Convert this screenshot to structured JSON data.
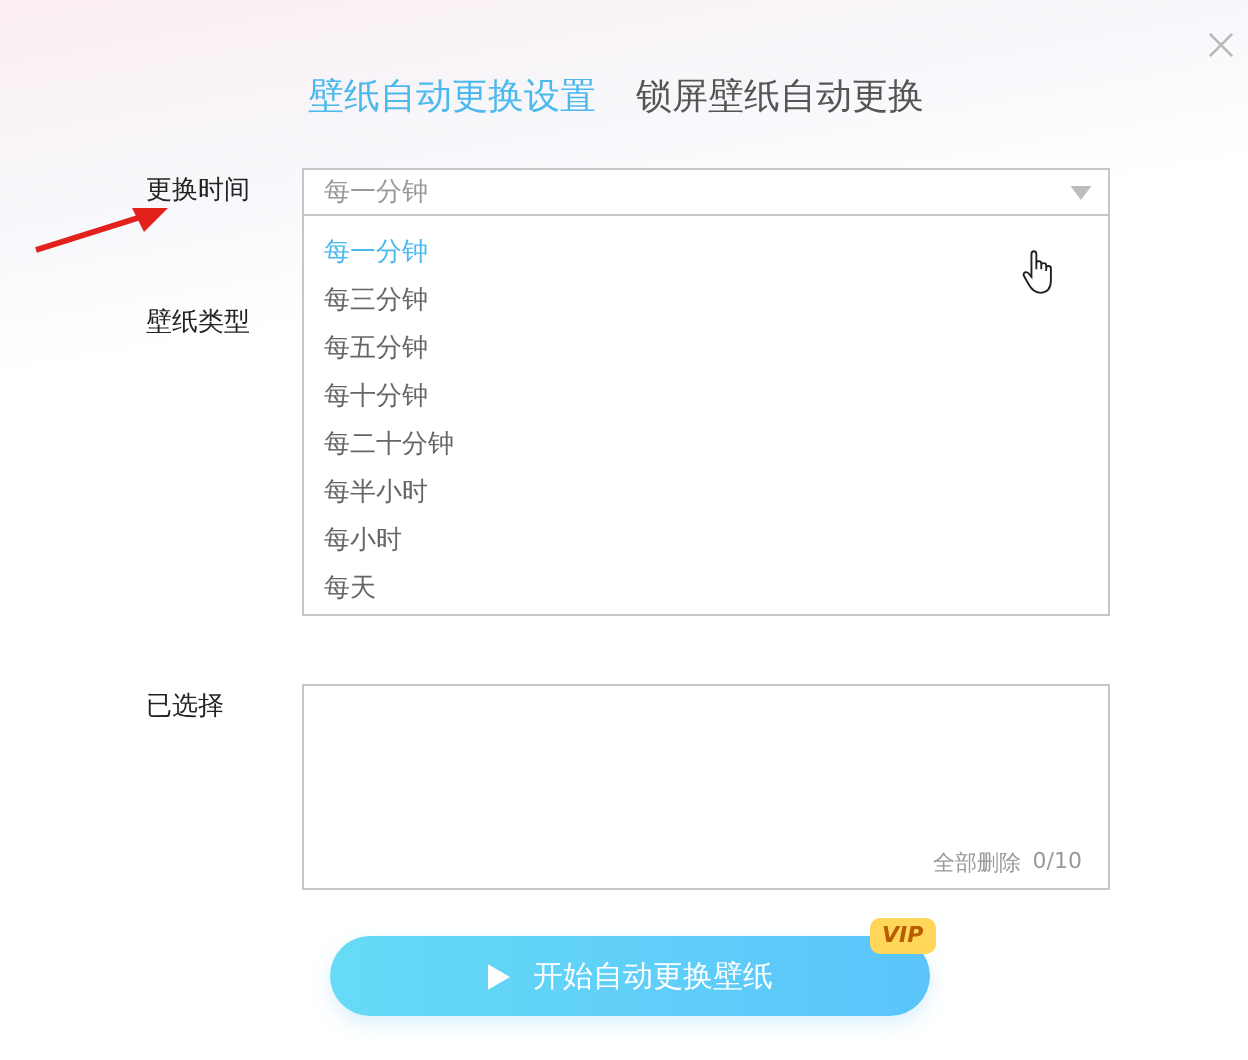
{
  "tabs": [
    {
      "label": "壁纸自动更换设置",
      "selected": true
    },
    {
      "label": "锁屏壁纸自动更换",
      "selected": false
    }
  ],
  "interval": {
    "label": "更换时间",
    "value": "每一分钟",
    "expanded": true,
    "options": [
      {
        "label": "每一分钟",
        "selected": true
      },
      {
        "label": "每三分钟",
        "selected": false
      },
      {
        "label": "每五分钟",
        "selected": false
      },
      {
        "label": "每十分钟",
        "selected": false
      },
      {
        "label": "每二十分钟",
        "selected": false
      },
      {
        "label": "每半小时",
        "selected": false
      },
      {
        "label": "每小时",
        "selected": false
      },
      {
        "label": "每天",
        "selected": false
      }
    ]
  },
  "wallpaper_type": {
    "label": "壁纸类型"
  },
  "selected_list": {
    "label": "已选择",
    "clear_all": "全部删除",
    "count": "0/10"
  },
  "start_button": {
    "label": "开始自动更换壁纸",
    "badge": "VIP"
  }
}
